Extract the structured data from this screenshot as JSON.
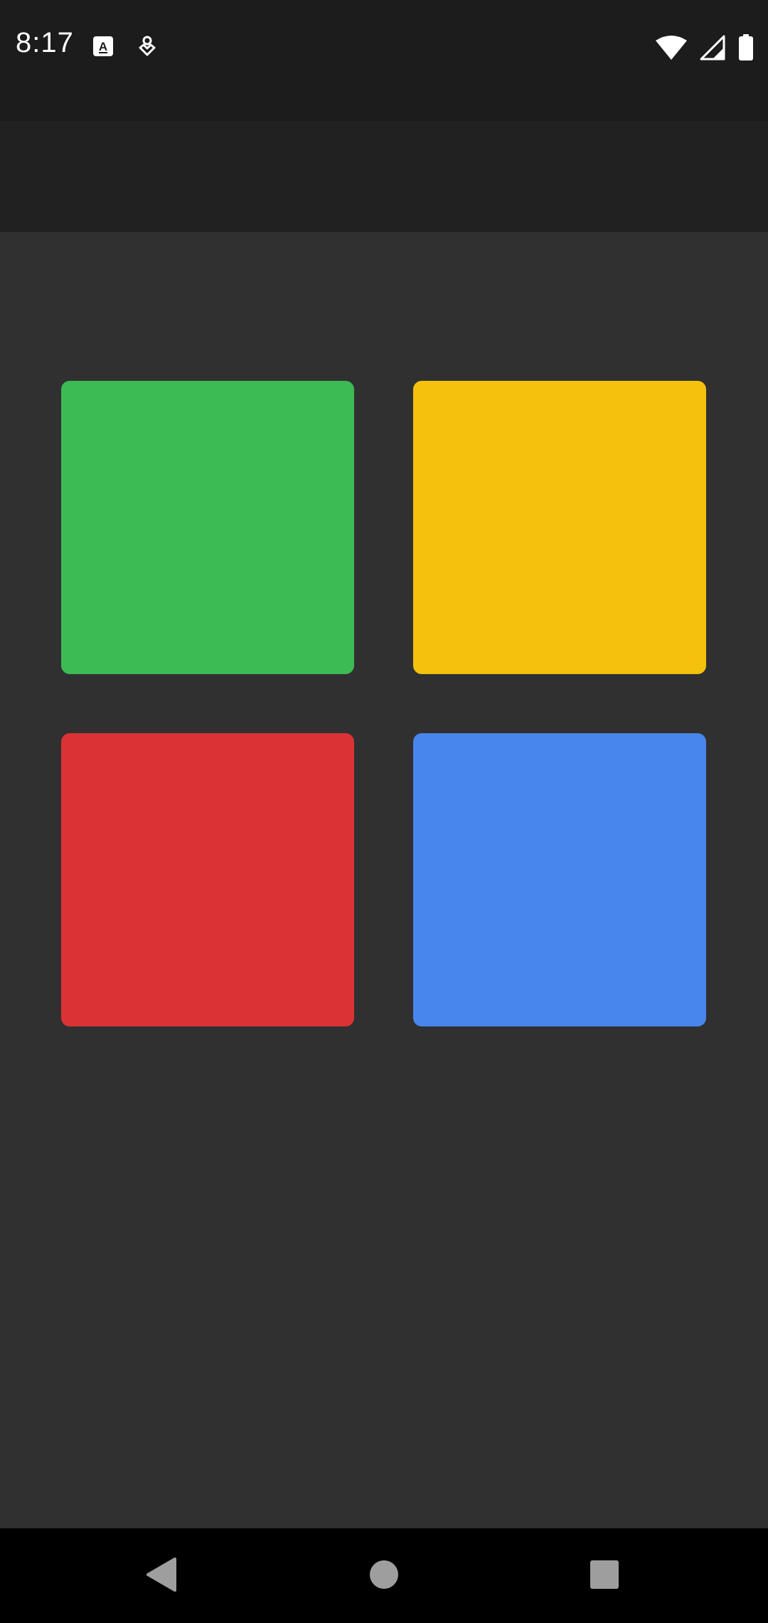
{
  "status_bar": {
    "time": "8:17",
    "icons_left": [
      "translate-icon",
      "assistant-icon"
    ],
    "icons_right": [
      "wifi-icon",
      "cellular-signal-icon",
      "battery-icon"
    ]
  },
  "app_bar": {
    "title": ""
  },
  "tiles": [
    {
      "color_name": "green",
      "color": "#3cba54"
    },
    {
      "color_name": "yellow",
      "color": "#f4c20d"
    },
    {
      "color_name": "red",
      "color": "#db3236"
    },
    {
      "color_name": "blue",
      "color": "#4885ed"
    }
  ],
  "nav_bar": {
    "buttons": [
      "back-icon",
      "home-icon",
      "recents-icon"
    ]
  },
  "colors": {
    "status_bar_bg": "#1c1c1c",
    "app_bar_bg": "#212121",
    "content_bg": "#303030",
    "nav_bar_bg": "#000000",
    "nav_icon": "#9e9e9e"
  }
}
